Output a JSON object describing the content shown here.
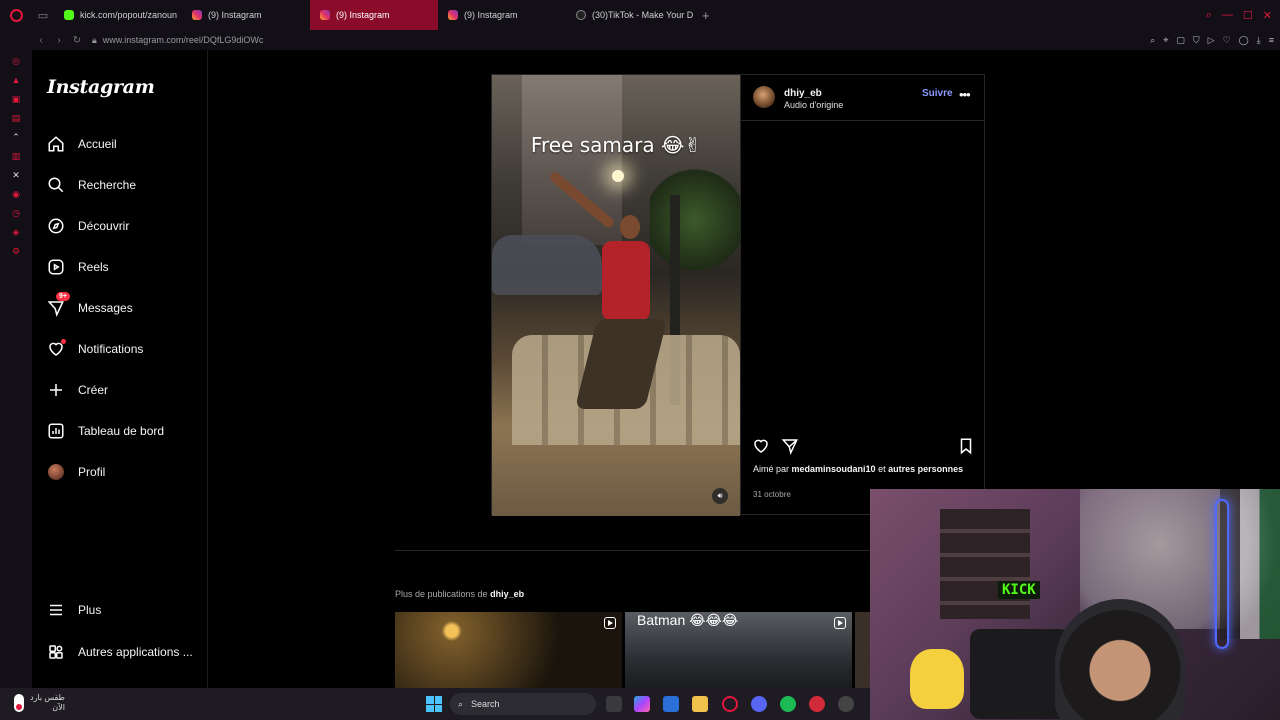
{
  "browser": {
    "tabs": [
      {
        "label": "kick.com/popout/zanoun",
        "favicon": "kick",
        "active": false
      },
      {
        "label": "(9) Instagram",
        "favicon": "instagram",
        "active": false
      },
      {
        "label": "(9) Instagram",
        "favicon": "instagram",
        "active": true
      },
      {
        "label": "(9) Instagram",
        "favicon": "instagram",
        "active": false
      },
      {
        "label": "(30)TikTok - Make Your D",
        "favicon": "tiktok",
        "active": false
      }
    ],
    "new_tab_label": "+",
    "url": "www.instagram.com/reel/DQfLG9diOWc",
    "accent_color": "#e0173b"
  },
  "instagram": {
    "logo": "Instagram",
    "nav": [
      {
        "label": "Accueil",
        "icon": "home-icon"
      },
      {
        "label": "Recherche",
        "icon": "search-icon"
      },
      {
        "label": "Découvrir",
        "icon": "compass-icon"
      },
      {
        "label": "Reels",
        "icon": "reels-icon"
      },
      {
        "label": "Messages",
        "icon": "messages-icon",
        "badge": "9+"
      },
      {
        "label": "Notifications",
        "icon": "heart-icon",
        "dot": true
      },
      {
        "label": "Créer",
        "icon": "plus-icon"
      },
      {
        "label": "Tableau de bord",
        "icon": "dashboard-icon"
      },
      {
        "label": "Profil",
        "icon": "profile-avatar"
      }
    ],
    "nav_bottom": [
      {
        "label": "Plus",
        "icon": "menu-icon"
      },
      {
        "label": "Autres applications ...",
        "icon": "apps-icon"
      }
    ],
    "post": {
      "author": "dhiy_eb",
      "audio": "Audio d'origine",
      "follow_label": "Suivre",
      "video_caption": "Free samara 😂✌",
      "liked_by_prefix": "Aimé par",
      "liked_by_user": "medaminsoudani10",
      "liked_by_joiner": "et",
      "liked_by_suffix": "autres personnes",
      "date": "31 octobre"
    },
    "more_posts": {
      "prefix": "Plus de publications de",
      "author": "dhiy_eb",
      "thumbs": [
        {
          "caption": ""
        },
        {
          "caption": "Batman 😂😂😂"
        },
        {
          "caption": ""
        }
      ]
    }
  },
  "webcam": {
    "sign_text": "KICK"
  },
  "taskbar": {
    "weather_line1": "طقس بارد",
    "weather_line2": "الآن",
    "search_label": "Search"
  }
}
